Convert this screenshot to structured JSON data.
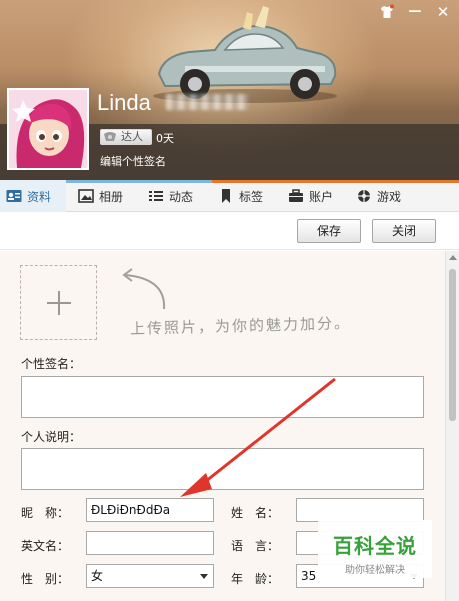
{
  "window": {
    "skin_icon": "tshirt-icon",
    "minimize_icon": "minimize-icon",
    "close_icon": "close-icon",
    "minimize_glyph": "—",
    "close_glyph": "✕"
  },
  "profile": {
    "nickname": "Linda",
    "level_badge": "达人",
    "days": "0天",
    "signature_link": "编辑个性签名"
  },
  "tabs": [
    {
      "label": "资料",
      "icon": "profile-card-icon",
      "active": true
    },
    {
      "label": "相册",
      "icon": "photo-album-icon",
      "active": false
    },
    {
      "label": "动态",
      "icon": "list-icon",
      "active": false
    },
    {
      "label": "标签",
      "icon": "bookmark-icon",
      "active": false
    },
    {
      "label": "账户",
      "icon": "briefcase-icon",
      "active": false
    },
    {
      "label": "游戏",
      "icon": "game-icon",
      "active": false
    }
  ],
  "toolbar": {
    "save_label": "保存",
    "close_label": "关闭"
  },
  "form": {
    "photo_hint": "上传照片，为你的魅力加分。",
    "signature_label": "个性签名：",
    "signature_value": "",
    "description_label": "个人说明：",
    "description_value": "",
    "nickname_label": "昵　称：",
    "nickname_value": "ÐLÐiÐnÐdÐa",
    "name_label": "姓　名：",
    "name_value": "",
    "english_name_label": "英文名：",
    "english_name_value": "",
    "language_label": "语　言：",
    "language_value": "",
    "gender_label": "性　别：",
    "gender_value": "女",
    "age_label": "年　龄：",
    "age_value": "35"
  },
  "watermark": {
    "title": "百科全说",
    "subtitle": "助你轻松解决"
  },
  "colors": {
    "tab_line_left": "#7fb6dc",
    "tab_line_right": "#e8772e",
    "annotation_arrow": "#e0352b",
    "watermark_green": "#37a13a"
  }
}
